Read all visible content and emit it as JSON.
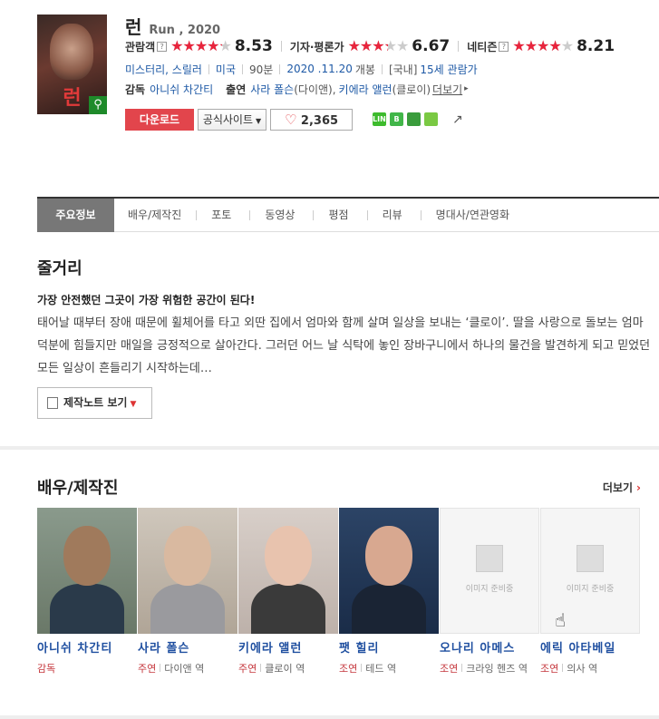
{
  "movie": {
    "title_ko": "런",
    "title_en": "Run , 2020",
    "poster_title": "런"
  },
  "ratings": [
    {
      "label": "관람객",
      "help": "?",
      "score": "8.53",
      "stars": 0.853
    },
    {
      "label": "기자·평론가",
      "help": "",
      "score": "6.67",
      "stars": 0.667
    },
    {
      "label": "네티즌",
      "help": "?",
      "score": "8.21",
      "stars": 0.821
    }
  ],
  "stars_glyph": "★★★★★",
  "meta": {
    "genre": "미스터리, 스릴러",
    "country": "미국",
    "runtime": "90분",
    "release_date": "2020 .11.20",
    "release_suffix": "개봉",
    "rating_prefix": "[국내]",
    "rating": "15세 관람가"
  },
  "credits": {
    "director_label": "감독",
    "director": "아니쉬 차간티",
    "cast_label": "출연",
    "actor1": "사라 폴슨",
    "actor1_role": "(다이앤),",
    "actor2": "키에라 앨런",
    "actor2_role": "(클로이)",
    "more": "더보기"
  },
  "actions": {
    "download": "다운로드",
    "official_site": "공식사이트",
    "like_count": "2,365"
  },
  "share_icons": [
    {
      "name": "line-share-icon",
      "label": "LINE",
      "color": "#3dbb2d"
    },
    {
      "name": "band-share-icon",
      "label": "B",
      "color": "#41b649"
    },
    {
      "name": "bookmark-share-icon",
      "label": "",
      "color": "#3a9c3c"
    },
    {
      "name": "memo-share-icon",
      "label": "",
      "color": "#7ac943"
    }
  ],
  "tabs": [
    "주요정보",
    "배우/제작진",
    "포토",
    "동영상",
    "평점",
    "리뷰",
    "명대사/연관영화"
  ],
  "story": {
    "heading": "줄거리",
    "tagline": "가장 안전했던 그곳이 가장 위험한 공간이 된다!",
    "text": "태어날 때부터 장애 때문에 휠체어를 타고 외딴 집에서 엄마와 함께 살며 일상을 보내는 ‘클로이’. 딸을 사랑으로 돌보는 엄마 덕분에 힘들지만 매일을 긍정적으로 살아간다. 그러던 어느 날 식탁에 놓인 장바구니에서 하나의 물건을 발견하게 되고 믿었던 모든 일상이 흔들리기 시작하는데…",
    "note_button": "제작노트 보기"
  },
  "cast_section": {
    "heading": "배우/제작진",
    "more": "더보기"
  },
  "cast": [
    {
      "name": "아니쉬 차간티",
      "role": "감독",
      "character": "",
      "photo": "ph1",
      "skin": "#a07a5c",
      "cloth": "#2a3a4a"
    },
    {
      "name": "사라 폴슨",
      "role": "주연",
      "character": "다이앤 역",
      "photo": "ph2",
      "skin": "#d9b9a0",
      "cloth": "#9a9a9e"
    },
    {
      "name": "키에라 앨런",
      "role": "주연",
      "character": "클로이 역",
      "photo": "ph3",
      "skin": "#e8c3ae",
      "cloth": "#3a3a3a"
    },
    {
      "name": "팻 힐리",
      "role": "조연",
      "character": "테드 역",
      "photo": "ph4",
      "skin": "#d8a890",
      "cloth": "#1a2434"
    },
    {
      "name": "오나리 아메스",
      "role": "조연",
      "character": "크라잉 헨즈 역",
      "photo": "ph0",
      "skin": "",
      "cloth": ""
    },
    {
      "name": "에릭 아타베일",
      "role": "조연",
      "character": "의사 역",
      "photo": "ph0",
      "skin": "",
      "cloth": ""
    }
  ],
  "no_image_text": "이미지 준비중"
}
